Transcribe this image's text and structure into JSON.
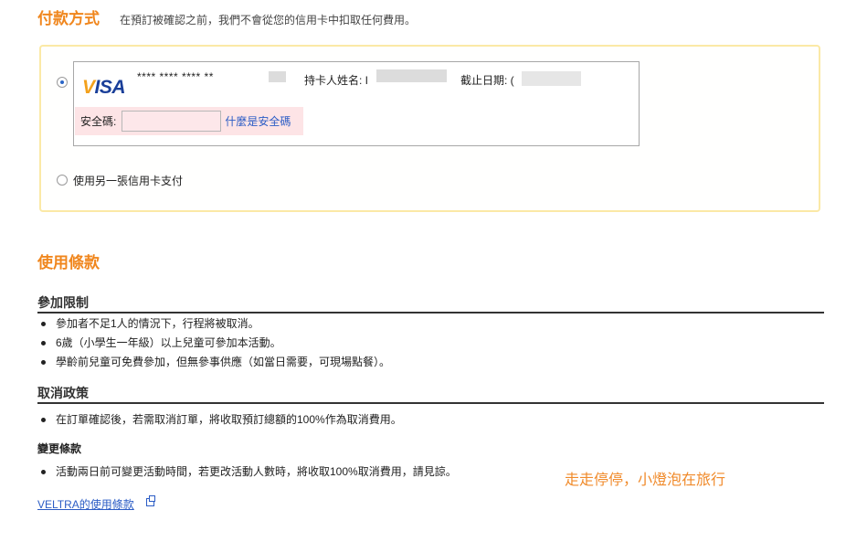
{
  "payment": {
    "title": "付款方式",
    "note": "在預訂被確認之前，我們不會從您的信用卡中扣取任何費用。",
    "card_brand": "VISA",
    "masked_number": "**** **** **** **",
    "holder_label": "持卡人姓名: I",
    "expiry_label": "截止日期: (",
    "security_label": "安全碼:",
    "security_value": "",
    "security_help": "什麼是安全碼",
    "new_card_label": "使用另一張信用卡支付"
  },
  "terms": {
    "title": "使用條款",
    "participation": {
      "heading": "參加限制",
      "items": [
        "參加者不足1人的情況下，行程將被取消。",
        "6歲（小學生一年級）以上兒童可參加本活動。",
        "學齡前兒童可免費參加，但無參事供應（如當日需要，可現場點餐）。"
      ]
    },
    "cancellation": {
      "heading": "取消政策",
      "items": [
        "在訂單確認後，若需取消訂單，將收取預訂總額的100%作為取消費用。"
      ]
    },
    "change": {
      "heading": "變更條款",
      "items": [
        "活動兩日前可變更活動時間，若更改活動人數時，將收取100%取消費用，請見諒。"
      ]
    },
    "link": "VELTRA的使用條款"
  },
  "watermark": "走走停停，小燈泡在旅行",
  "icons": {
    "card": "visa-card-icon",
    "external": "external-link-icon"
  },
  "colors": {
    "accent": "#f0861d",
    "link": "#2b5cc5",
    "box_border": "#fbe9a6",
    "security_bg": "#fde4e6"
  }
}
